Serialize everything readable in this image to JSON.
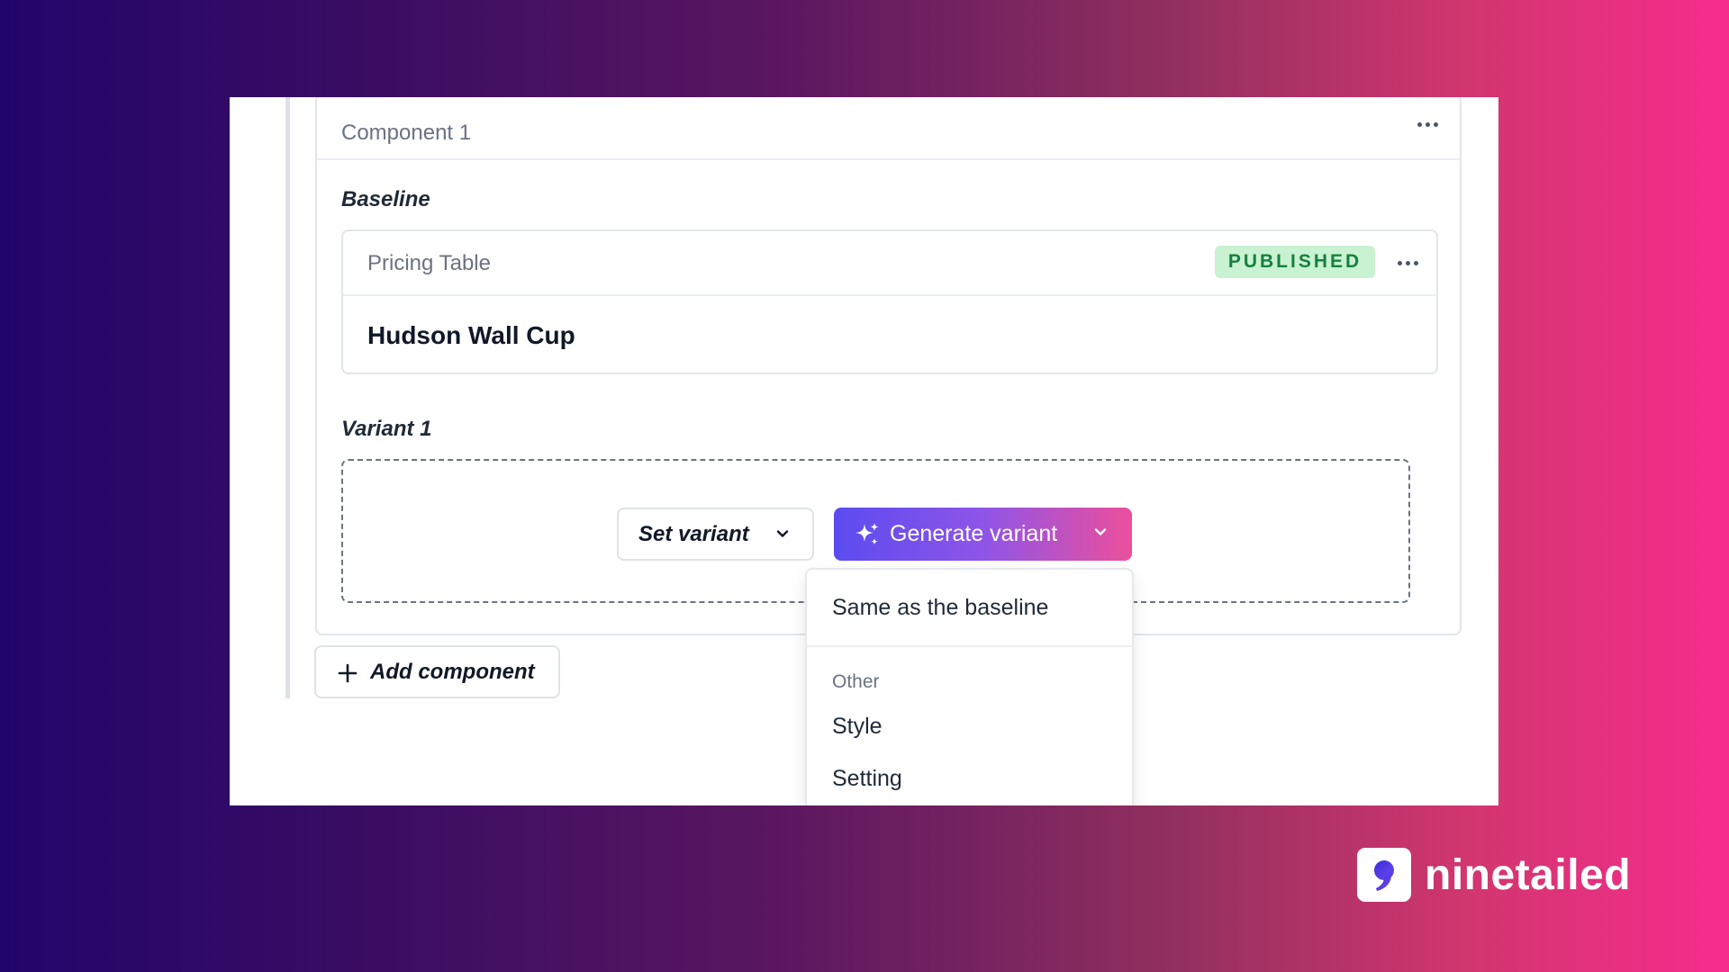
{
  "component": {
    "title": "Component 1",
    "menu_icon": "more-horizontal-icon"
  },
  "baseline": {
    "section_label": "Baseline",
    "card_title": "Pricing Table",
    "status_badge": "PUBLISHED",
    "status_color": "#15803d",
    "product_name": "Hudson Wall Cup"
  },
  "variant": {
    "section_label": "Variant 1",
    "set_variant_label": "Set variant",
    "generate_variant_label": "Generate variant"
  },
  "dropdown": {
    "primary_item": "Same as the baseline",
    "group_label": "Other",
    "items": [
      "Style",
      "Setting"
    ]
  },
  "add_component_label": "Add component",
  "brand": {
    "name": "ninetailed",
    "accent_color": "#5b4bf0",
    "gradient_end_color": "#f62c8d"
  }
}
